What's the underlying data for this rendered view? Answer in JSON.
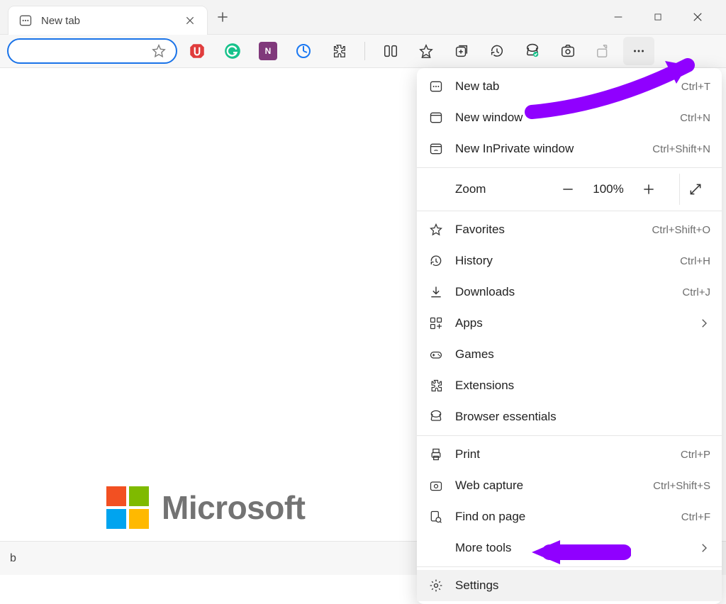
{
  "tab": {
    "title": "New tab"
  },
  "toolbar": {
    "address_value": ""
  },
  "content": {
    "brand_text": "Microsoft"
  },
  "bottom_bar": {
    "text": "b"
  },
  "menu": {
    "new_tab": {
      "label": "New tab",
      "shortcut": "Ctrl+T"
    },
    "new_window": {
      "label": "New window",
      "shortcut": "Ctrl+N"
    },
    "new_inprivate": {
      "label": "New InPrivate window",
      "shortcut": "Ctrl+Shift+N"
    },
    "zoom": {
      "label": "Zoom",
      "value": "100%"
    },
    "favorites": {
      "label": "Favorites",
      "shortcut": "Ctrl+Shift+O"
    },
    "history": {
      "label": "History",
      "shortcut": "Ctrl+H"
    },
    "downloads": {
      "label": "Downloads",
      "shortcut": "Ctrl+J"
    },
    "apps": {
      "label": "Apps"
    },
    "games": {
      "label": "Games"
    },
    "extensions": {
      "label": "Extensions"
    },
    "browser_ess": {
      "label": "Browser essentials"
    },
    "print": {
      "label": "Print",
      "shortcut": "Ctrl+P"
    },
    "web_capture": {
      "label": "Web capture",
      "shortcut": "Ctrl+Shift+S"
    },
    "find": {
      "label": "Find on page",
      "shortcut": "Ctrl+F"
    },
    "more_tools": {
      "label": "More tools"
    },
    "settings": {
      "label": "Settings"
    }
  }
}
